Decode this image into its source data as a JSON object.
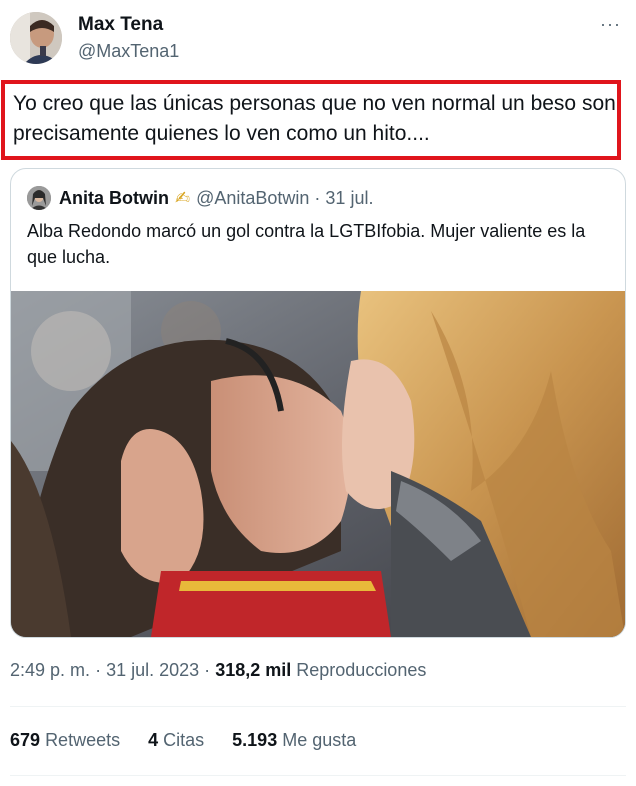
{
  "author": {
    "name": "Max Tena",
    "handle": "@MaxTena1",
    "more_label": "···"
  },
  "tweet": {
    "text": "Yo creo que las únicas personas que no ven normal un beso son precisamente quienes lo ven como un hito...."
  },
  "quoted": {
    "name": "Anita Botwin",
    "emoji": "✍",
    "handle": "@AnitaBotwin",
    "separator": "·",
    "date": "31 jul.",
    "text": "Alba Redondo marcó un gol contra la LGTBIfobia. Mujer valiente es la que lucha."
  },
  "meta": {
    "time": "2:49 p. m.",
    "sep": "·",
    "date": "31 jul. 2023",
    "views_count": "318,2 mil",
    "views_label": "Reproducciones"
  },
  "stats": {
    "retweets_count": "679",
    "retweets_label": "Retweets",
    "quotes_count": "4",
    "quotes_label": "Citas",
    "likes_count": "5.193",
    "likes_label": "Me gusta"
  },
  "colors": {
    "highlight_border": "#e0151c",
    "secondary_text": "#536471",
    "border": "#cfd9de"
  }
}
